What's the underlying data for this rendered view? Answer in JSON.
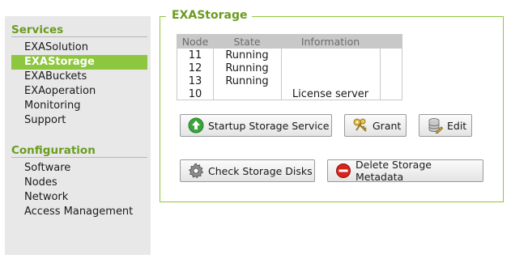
{
  "sidebar": {
    "services_title": "Services",
    "services": [
      {
        "label": "EXASolution"
      },
      {
        "label": "EXAStorage",
        "active": true
      },
      {
        "label": "EXABuckets"
      },
      {
        "label": "EXAoperation"
      },
      {
        "label": "Monitoring"
      },
      {
        "label": "Support"
      }
    ],
    "configuration_title": "Configuration",
    "configuration": [
      {
        "label": "Software"
      },
      {
        "label": "Nodes"
      },
      {
        "label": "Network"
      },
      {
        "label": "Access Management"
      }
    ]
  },
  "panel": {
    "title": "EXAStorage",
    "table": {
      "headers": [
        "Node",
        "State",
        "Information"
      ],
      "rows": [
        {
          "node": "11",
          "state": "Running",
          "info": ""
        },
        {
          "node": "12",
          "state": "Running",
          "info": ""
        },
        {
          "node": "13",
          "state": "Running",
          "info": ""
        },
        {
          "node": "10",
          "state": "",
          "info": "License server"
        }
      ]
    },
    "buttons": {
      "startup": {
        "label": "Startup Storage Service",
        "icon": "arrow-up-green-icon"
      },
      "grant": {
        "label": "Grant",
        "icon": "keys-icon"
      },
      "edit": {
        "label": "Edit",
        "icon": "database-edit-icon"
      },
      "check_disks": {
        "label": "Check Storage Disks",
        "icon": "gear-icon"
      },
      "delete_metadata": {
        "label": "Delete Storage Metadata",
        "icon": "delete-red-icon"
      }
    }
  },
  "colors": {
    "accent": "#8dc63f",
    "accent_text": "#6a9c1f",
    "sidebar_bg": "#e8e8e8",
    "table_header_bg": "#c8c8c8"
  }
}
